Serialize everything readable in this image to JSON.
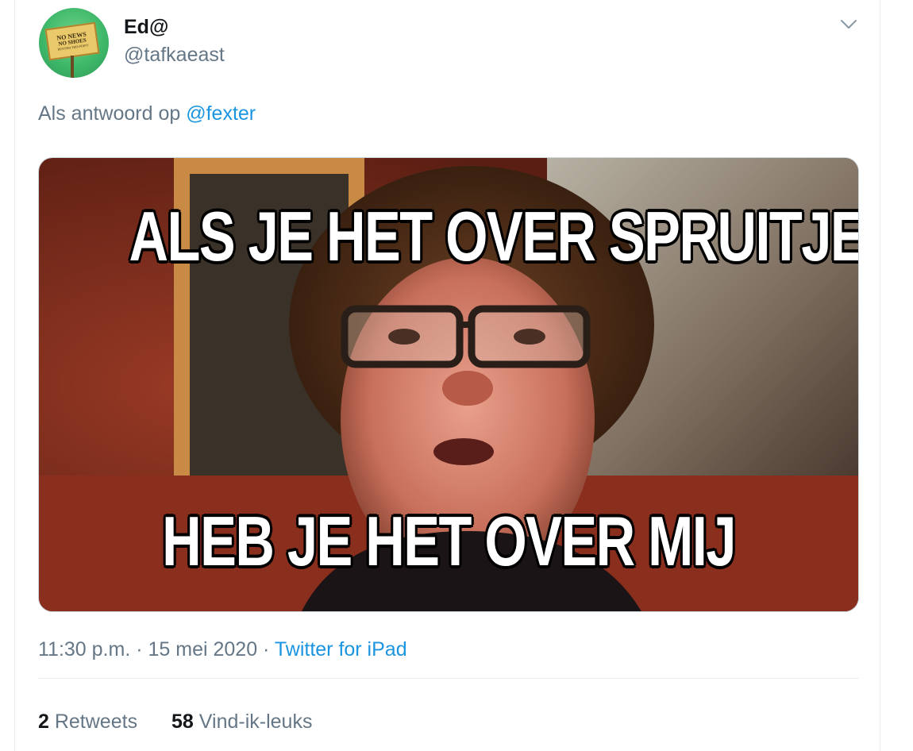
{
  "tweet": {
    "author": {
      "display_name": "Ed@",
      "username": "@tafkaeast",
      "avatar_sign_lines": [
        "NO NEWS",
        "NO SHOES",
        "BEYOND THIS POINT"
      ]
    },
    "more_icon": "chevron-down-icon",
    "reply": {
      "prefix": "Als antwoord op ",
      "mention": "@fexter"
    },
    "media": {
      "top_text": "ALS JE HET OVER SPRUITJES HEBT",
      "bottom_text": "HEB JE HET OVER MIJ"
    },
    "meta": {
      "time": "11:30 p.m.",
      "sep1": " · ",
      "date": "15 mei 2020",
      "sep2": " · ",
      "source": "Twitter for iPad"
    },
    "stats": {
      "retweets_count": "2",
      "retweets_label": " Retweets",
      "likes_count": "58",
      "likes_label": " Vind-ik-leuks"
    }
  },
  "colors": {
    "text_primary": "#14171a",
    "text_secondary": "#657786",
    "link": "#1b95e0",
    "border": "#e6ecf0"
  }
}
